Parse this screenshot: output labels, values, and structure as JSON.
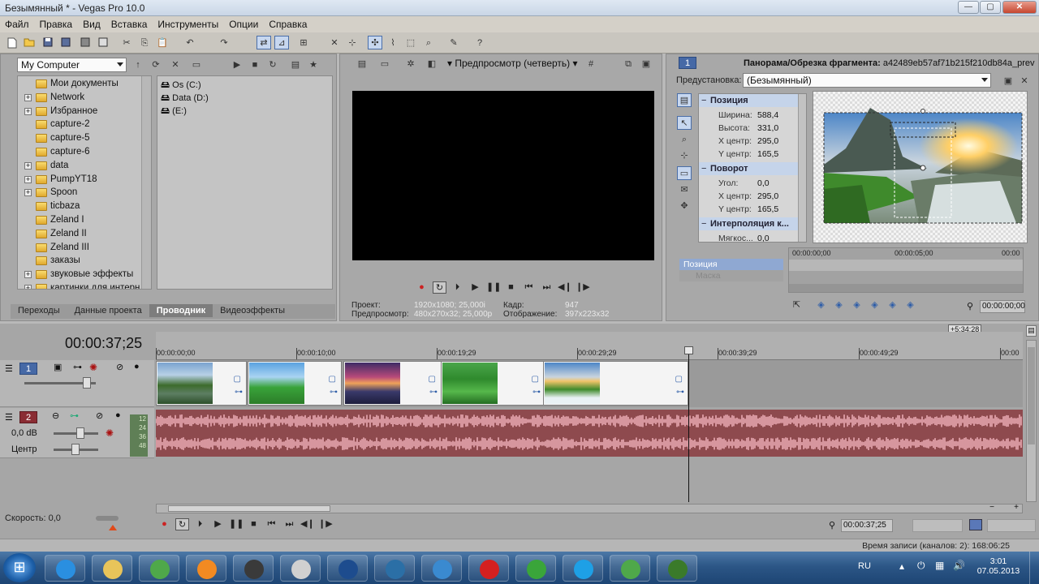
{
  "window": {
    "title": "Безымянный * - Vegas Pro 10.0",
    "minimize_glyph": "—",
    "maximize_glyph": "▢",
    "close_glyph": "✕"
  },
  "menu": [
    "Файл",
    "Правка",
    "Вид",
    "Вставка",
    "Инструменты",
    "Опции",
    "Справка"
  ],
  "explorer": {
    "location": "My Computer",
    "tree": [
      {
        "label": "Мои документы",
        "expandable": false
      },
      {
        "label": "Network",
        "expandable": true
      },
      {
        "label": "Избранное",
        "expandable": true
      },
      {
        "label": "capture-2",
        "expandable": false
      },
      {
        "label": "capture-5",
        "expandable": false
      },
      {
        "label": "capture-6",
        "expandable": false
      },
      {
        "label": "data",
        "expandable": true
      },
      {
        "label": "PumpYT18",
        "expandable": true
      },
      {
        "label": "Spoon",
        "expandable": true
      },
      {
        "label": "ticbaza",
        "expandable": false
      },
      {
        "label": "Zeland I",
        "expandable": false
      },
      {
        "label": "Zeland II",
        "expandable": false
      },
      {
        "label": "Zeland III",
        "expandable": false
      },
      {
        "label": "заказы",
        "expandable": false
      },
      {
        "label": "звуковые эффекты",
        "expandable": true
      },
      {
        "label": "картинки для интерн",
        "expandable": true
      }
    ],
    "drives": [
      "Os (C:)",
      "Data (D:)",
      "(E:)"
    ],
    "tabs": [
      "Переходы",
      "Данные проекта",
      "Проводник",
      "Видеоэффекты"
    ],
    "active_tab": "Проводник"
  },
  "preview": {
    "mode": "Предпросмотр (четверть)",
    "project_label": "Проект:",
    "project_value": "1920x1080; 25,000i",
    "preview_label": "Предпросмотр:",
    "preview_value": "480x270x32; 25,000p",
    "frame_label": "Кадр:",
    "frame_value": "947",
    "display_label": "Отображение:",
    "display_value": "397x223x32"
  },
  "pan_crop": {
    "header_num": "1",
    "title": "Панорама/Обрезка фрагмента:",
    "clip_id": "a42489eb57af71b215f210db84a_prev",
    "preset_label": "Предустановка:",
    "preset_value": "(Безымянный)",
    "sections": [
      {
        "name": "Позиция",
        "rows": [
          [
            "Ширина:",
            "588,4"
          ],
          [
            "Высота:",
            "331,0"
          ],
          [
            "X центр:",
            "295,0"
          ],
          [
            "Y центр:",
            "165,5"
          ]
        ]
      },
      {
        "name": "Поворот",
        "rows": [
          [
            "Угол:",
            "0,0"
          ],
          [
            "X центр:",
            "295,0"
          ],
          [
            "Y центр:",
            "165,5"
          ]
        ]
      },
      {
        "name": "Интерполяция к...",
        "rows": [
          [
            "Мягкос...",
            "0,0"
          ]
        ]
      }
    ],
    "keyframe_tracks": [
      "Позиция",
      "Маска"
    ],
    "kf_ruler": [
      "00:00:00;00",
      "00:00:05;00",
      "00:00"
    ],
    "kf_time": "00:00:00;00"
  },
  "timeline": {
    "cursor_time": "00:00:37;25",
    "tag": "+5:34:28",
    "ruler": [
      "00:00:00;00",
      "00:00:10;00",
      "00:00:19;29",
      "00:00:29;29",
      "00:00:39;29",
      "00:00:49;29",
      "00:00"
    ],
    "video_track_num": "1",
    "audio_track_num": "2",
    "audio_volume": "0,0 dB",
    "audio_pan": "Центр",
    "meter_labels": [
      "12",
      "24",
      "36",
      "48"
    ],
    "speed": "Скорость: 0,0",
    "transport_time": "00:00:37;25",
    "record_info": "Время записи (каналов: 2): 168:06:25"
  },
  "taskbar": {
    "start_glyph": "⊞",
    "lang": "RU",
    "time": "3:01",
    "date": "07.05.2013",
    "apps": [
      "Internet Explorer",
      "Explorer",
      "Chrome",
      "Media",
      "Vegas",
      "Desktop",
      "Photoshop",
      "Media Player",
      "Network",
      "Opera",
      "Agent",
      "Skype",
      "Chrome",
      "Vegas Pro"
    ]
  }
}
